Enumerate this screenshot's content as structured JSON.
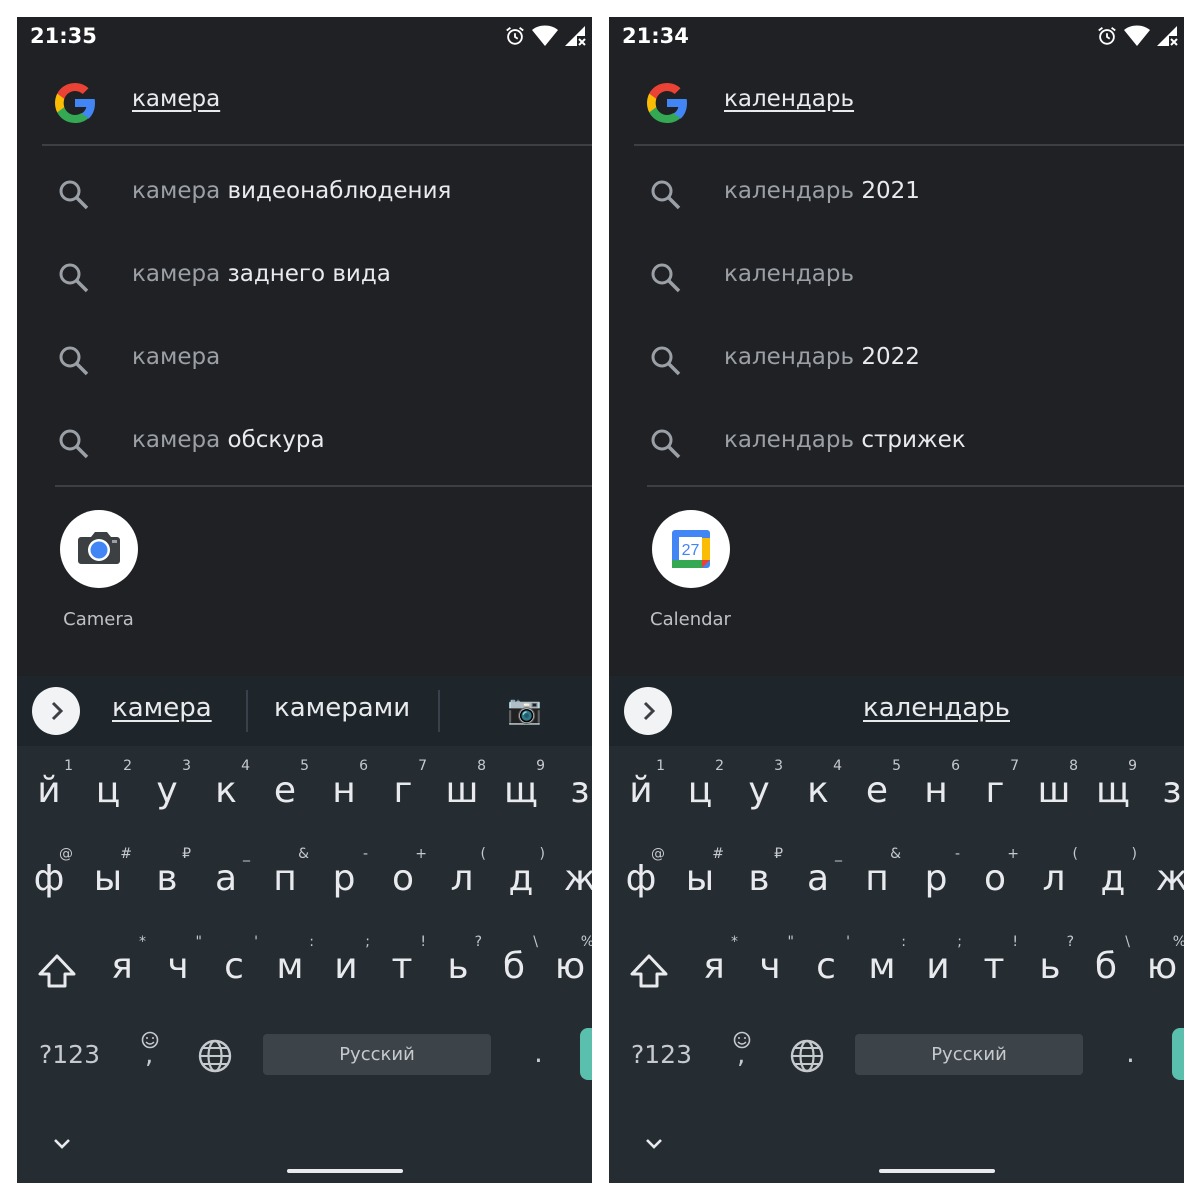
{
  "panels": [
    {
      "time": "21:35",
      "query": "камера",
      "suggestions": [
        {
          "base": "камера",
          "rest": " видеонаблюдения"
        },
        {
          "base": "камера",
          "rest": " заднего вида"
        },
        {
          "base": "камера",
          "rest": ""
        },
        {
          "base": "камера",
          "rest": " обскура"
        }
      ],
      "app": {
        "label": "Camera",
        "icon": "camera-app-icon"
      },
      "candidates": [
        "камера",
        "камерами"
      ],
      "candidate_emoji": "📷"
    },
    {
      "time": "21:34",
      "query": "календарь",
      "suggestions": [
        {
          "base": "календарь",
          "rest": " 2021"
        },
        {
          "base": "календарь",
          "rest": ""
        },
        {
          "base": "календарь",
          "rest": " 2022"
        },
        {
          "base": "календарь",
          "rest": " стрижек"
        }
      ],
      "app": {
        "label": "Calendar",
        "icon": "calendar-app-icon",
        "day": "27"
      },
      "candidates": [
        "календарь"
      ]
    }
  ],
  "keyboard": {
    "row1": [
      {
        "ch": "й",
        "hint": "1"
      },
      {
        "ch": "ц",
        "hint": "2"
      },
      {
        "ch": "у",
        "hint": "3"
      },
      {
        "ch": "к",
        "hint": "4"
      },
      {
        "ch": "е",
        "hint": "5"
      },
      {
        "ch": "н",
        "hint": "6"
      },
      {
        "ch": "г",
        "hint": "7"
      },
      {
        "ch": "ш",
        "hint": "8"
      },
      {
        "ch": "щ",
        "hint": "9"
      },
      {
        "ch": "з",
        "hint": ""
      }
    ],
    "row2": [
      {
        "ch": "ф",
        "hint": "@"
      },
      {
        "ch": "ы",
        "hint": "#"
      },
      {
        "ch": "в",
        "hint": "₽"
      },
      {
        "ch": "а",
        "hint": "_"
      },
      {
        "ch": "п",
        "hint": "&"
      },
      {
        "ch": "р",
        "hint": "-"
      },
      {
        "ch": "о",
        "hint": "+"
      },
      {
        "ch": "л",
        "hint": "("
      },
      {
        "ch": "д",
        "hint": ")"
      },
      {
        "ch": "ж",
        "hint": ""
      }
    ],
    "row3": [
      {
        "ch": "я",
        "hint": "*"
      },
      {
        "ch": "ч",
        "hint": "\""
      },
      {
        "ch": "с",
        "hint": "'"
      },
      {
        "ch": "м",
        "hint": ":"
      },
      {
        "ch": "и",
        "hint": ";"
      },
      {
        "ch": "т",
        "hint": "!"
      },
      {
        "ch": "ь",
        "hint": "?"
      },
      {
        "ch": "б",
        "hint": "\\"
      },
      {
        "ch": "ю",
        "hint": "%"
      }
    ],
    "symbols_label": "?123",
    "emoji_comma_label": ",",
    "space_label": "Русский",
    "period_label": ".",
    "icons": {
      "shift": "shift-icon",
      "emoji": "emoji-icon",
      "globe": "globe-icon",
      "collapse": "chevron-down-icon",
      "expand": "chevron-right-icon"
    }
  },
  "colors": {
    "screen_bg": "#202124",
    "keyboard_bg": "#252c32",
    "accent_enter": "#5bbfad",
    "google_blue": "#4285F4",
    "google_red": "#EA4335",
    "google_yellow": "#FBBC05",
    "google_green": "#34A853"
  }
}
